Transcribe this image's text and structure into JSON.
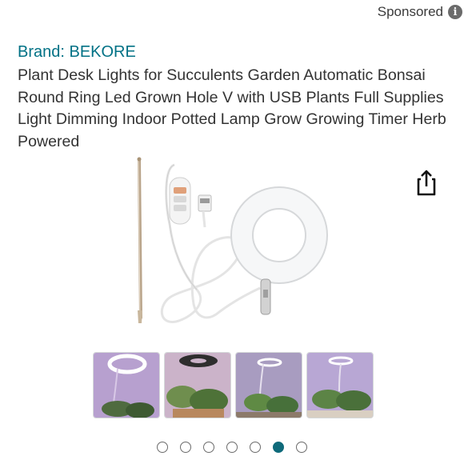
{
  "sponsored": {
    "label": "Sponsored",
    "info_icon": "info-icon"
  },
  "product": {
    "brand": "Brand: BEKORE",
    "title": "Plant Desk Lights for Succulents Garden Automatic Bonsai Round Ring Led Grown Hole V with USB Plants Full Supplies Light Dimming Indoor Potted Lamp Grow Growing Timer Herb Powered"
  },
  "share": {
    "icon": "share-icon"
  },
  "gallery": {
    "thumbnails": [
      {
        "name": "ring-light-glow-thumbnail"
      },
      {
        "name": "ring-light-plants-thumbnail"
      },
      {
        "name": "ring-light-succulents-thumbnail"
      },
      {
        "name": "ring-light-pot-thumbnail"
      }
    ],
    "dots_total": 7,
    "active_dot": 6
  },
  "colors": {
    "brand_link": "#007185",
    "active_dot": "#0f6a7a"
  }
}
